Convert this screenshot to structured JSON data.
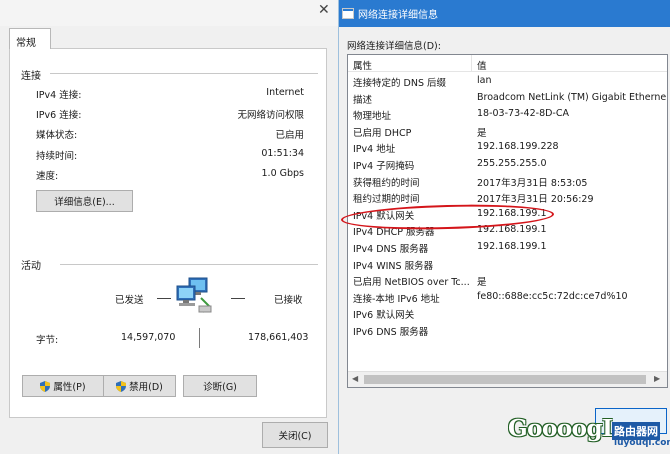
{
  "status_window": {
    "tab": "常规",
    "connection": {
      "heading": "连接",
      "rows": [
        {
          "label": "IPv4 连接:",
          "value": "Internet"
        },
        {
          "label": "IPv6 连接:",
          "value": "无网络访问权限"
        },
        {
          "label": "媒体状态:",
          "value": "已启用"
        },
        {
          "label": "持续时间:",
          "value": "01:51:34"
        },
        {
          "label": "速度:",
          "value": "1.0 Gbps"
        }
      ],
      "details_button": "详细信息(E)..."
    },
    "activity": {
      "heading": "活动",
      "sent_label": "已发送",
      "received_label": "已接收",
      "bytes_label": "字节:",
      "bytes_sent": "14,597,070",
      "bytes_received": "178,661,403"
    },
    "buttons": {
      "properties": "属性(P)",
      "disable": "禁用(D)",
      "diagnose": "诊断(G)",
      "close": "关闭(C)"
    }
  },
  "details_window": {
    "title": "网络连接详细信息",
    "caption": "网络连接详细信息(D):",
    "columns": {
      "property": "属性",
      "value": "值"
    },
    "rows": [
      {
        "property": "连接特定的 DNS 后缀",
        "value": "lan"
      },
      {
        "property": "描述",
        "value": "Broadcom NetLink (TM) Gigabit Etherne"
      },
      {
        "property": "物理地址",
        "value": "18-03-73-42-8D-CA"
      },
      {
        "property": "已启用 DHCP",
        "value": "是"
      },
      {
        "property": "IPv4 地址",
        "value": "192.168.199.228"
      },
      {
        "property": "IPv4 子网掩码",
        "value": "255.255.255.0"
      },
      {
        "property": "获得租约的时间",
        "value": "2017年3月31日 8:53:05"
      },
      {
        "property": "租约过期的时间",
        "value": "2017年3月31日 20:56:29"
      },
      {
        "property": "IPv4 默认网关",
        "value": "192.168.199.1"
      },
      {
        "property": "IPv4 DHCP 服务器",
        "value": "192.168.199.1"
      },
      {
        "property": "IPv4 DNS 服务器",
        "value": "192.168.199.1"
      },
      {
        "property": "IPv4 WINS 服务器",
        "value": ""
      },
      {
        "property": "已启用 NetBIOS over Tc...",
        "value": "是"
      },
      {
        "property": "连接-本地 IPv6 地址",
        "value": "fe80::688e:cc5c:72dc:ce7d%10"
      },
      {
        "property": "IPv6 默认网关",
        "value": ""
      },
      {
        "property": "IPv6 DNS 服务器",
        "value": ""
      }
    ]
  },
  "watermark": {
    "logo": "GoooogL",
    "cn": "路由器网",
    "domain": "luyouqi.com"
  },
  "colors": {
    "titlebar": "#2a7ad0",
    "highlight": "#d4151a",
    "watermark_green": "#225f25",
    "watermark_blue": "#1e5aa6"
  },
  "icons": [
    "shield-icon",
    "network-computers-icon",
    "close-icon",
    "window-icon"
  ]
}
